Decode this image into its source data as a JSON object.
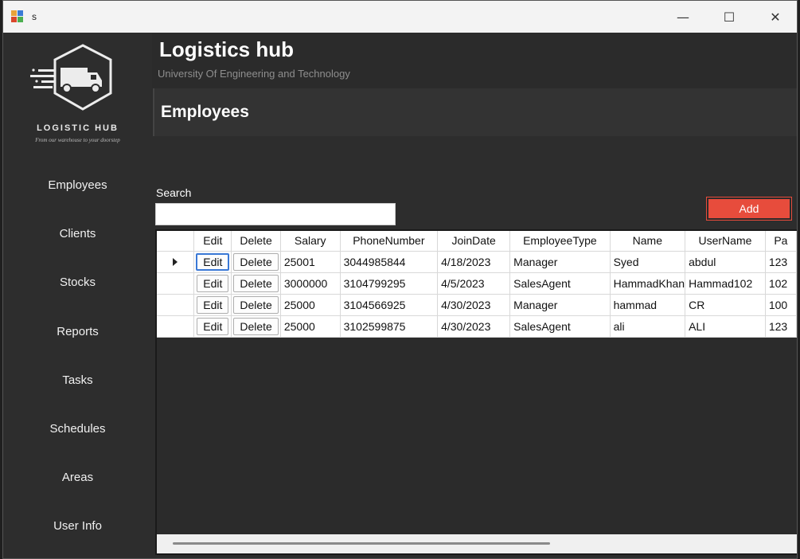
{
  "window": {
    "title": "s",
    "minimize_glyph": "—",
    "maximize_glyph": "☐",
    "close_glyph": "✕"
  },
  "logo": {
    "title": "LOGISTIC HUB",
    "tagline": "From our warehouse to your doorstep"
  },
  "sidebar": {
    "items": [
      {
        "label": "Employees"
      },
      {
        "label": "Clients"
      },
      {
        "label": "Stocks"
      },
      {
        "label": "Reports"
      },
      {
        "label": "Tasks"
      },
      {
        "label": "Schedules"
      },
      {
        "label": "Areas"
      },
      {
        "label": "User Info"
      }
    ]
  },
  "header": {
    "title": "Logistics hub",
    "subtitle": "University Of Engineering and Technology"
  },
  "section": {
    "title": "Employees"
  },
  "search": {
    "label": "Search",
    "value": ""
  },
  "add_button": {
    "label": "Add"
  },
  "grid": {
    "columns": [
      "Edit",
      "Delete",
      "Salary",
      "PhoneNumber",
      "JoinDate",
      "EmployeeType",
      "Name",
      "UserName",
      "Pa"
    ],
    "edit_label": "Edit",
    "delete_label": "Delete",
    "rows": [
      {
        "salary": "25001",
        "phone": "3044985844",
        "join": "4/18/2023",
        "type": "Manager",
        "name": "Syed",
        "username": "abdul",
        "pa": "123"
      },
      {
        "salary": "3000000",
        "phone": "3104799295",
        "join": "4/5/2023",
        "type": "SalesAgent",
        "name": "HammadKhan",
        "username": "Hammad102",
        "pa": "102"
      },
      {
        "salary": "25000",
        "phone": "3104566925",
        "join": "4/30/2023",
        "type": "Manager",
        "name": "hammad",
        "username": "CR",
        "pa": "100"
      },
      {
        "salary": "25000",
        "phone": "3102599875",
        "join": "4/30/2023",
        "type": "SalesAgent",
        "name": "ali",
        "username": "ALI",
        "pa": "123"
      }
    ]
  },
  "colors": {
    "accent": "#e74c3c",
    "background": "#2b2b2b",
    "focus": "#3a78d6"
  }
}
